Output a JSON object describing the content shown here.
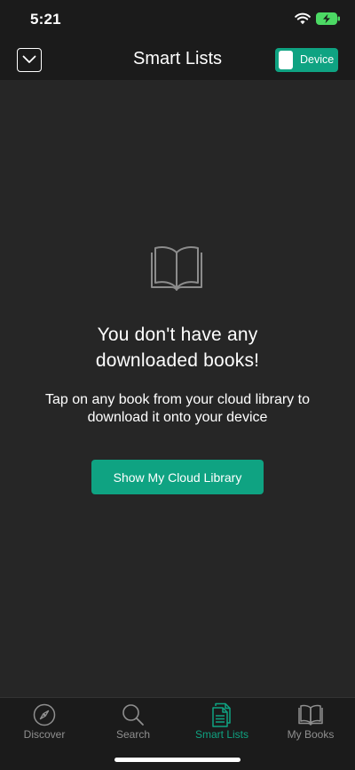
{
  "status_bar": {
    "time": "5:21",
    "icons": [
      "wifi-icon",
      "battery-charging-icon"
    ]
  },
  "nav": {
    "collapse_icon": "chevron-down-icon",
    "title": "Smart Lists",
    "device_toggle_label": "Device",
    "device_toggle_on": true
  },
  "empty_state": {
    "icon": "open-book-icon",
    "heading_line1": "You don't have any",
    "heading_line2": "downloaded books!",
    "sub_line1": "Tap on any book from your cloud library to",
    "sub_line2": "download it onto your device",
    "button_label": "Show My Cloud Library"
  },
  "tabs": [
    {
      "label": "Discover",
      "icon": "compass-icon",
      "active": false
    },
    {
      "label": "Search",
      "icon": "search-icon",
      "active": false
    },
    {
      "label": "Smart Lists",
      "icon": "documents-icon",
      "active": true
    },
    {
      "label": "My Books",
      "icon": "book-icon",
      "active": false
    }
  ],
  "colors": {
    "accent": "#0fa382",
    "background": "#262626",
    "bar_background": "#1b1b1b",
    "inactive_tab": "#8f8f8f"
  }
}
